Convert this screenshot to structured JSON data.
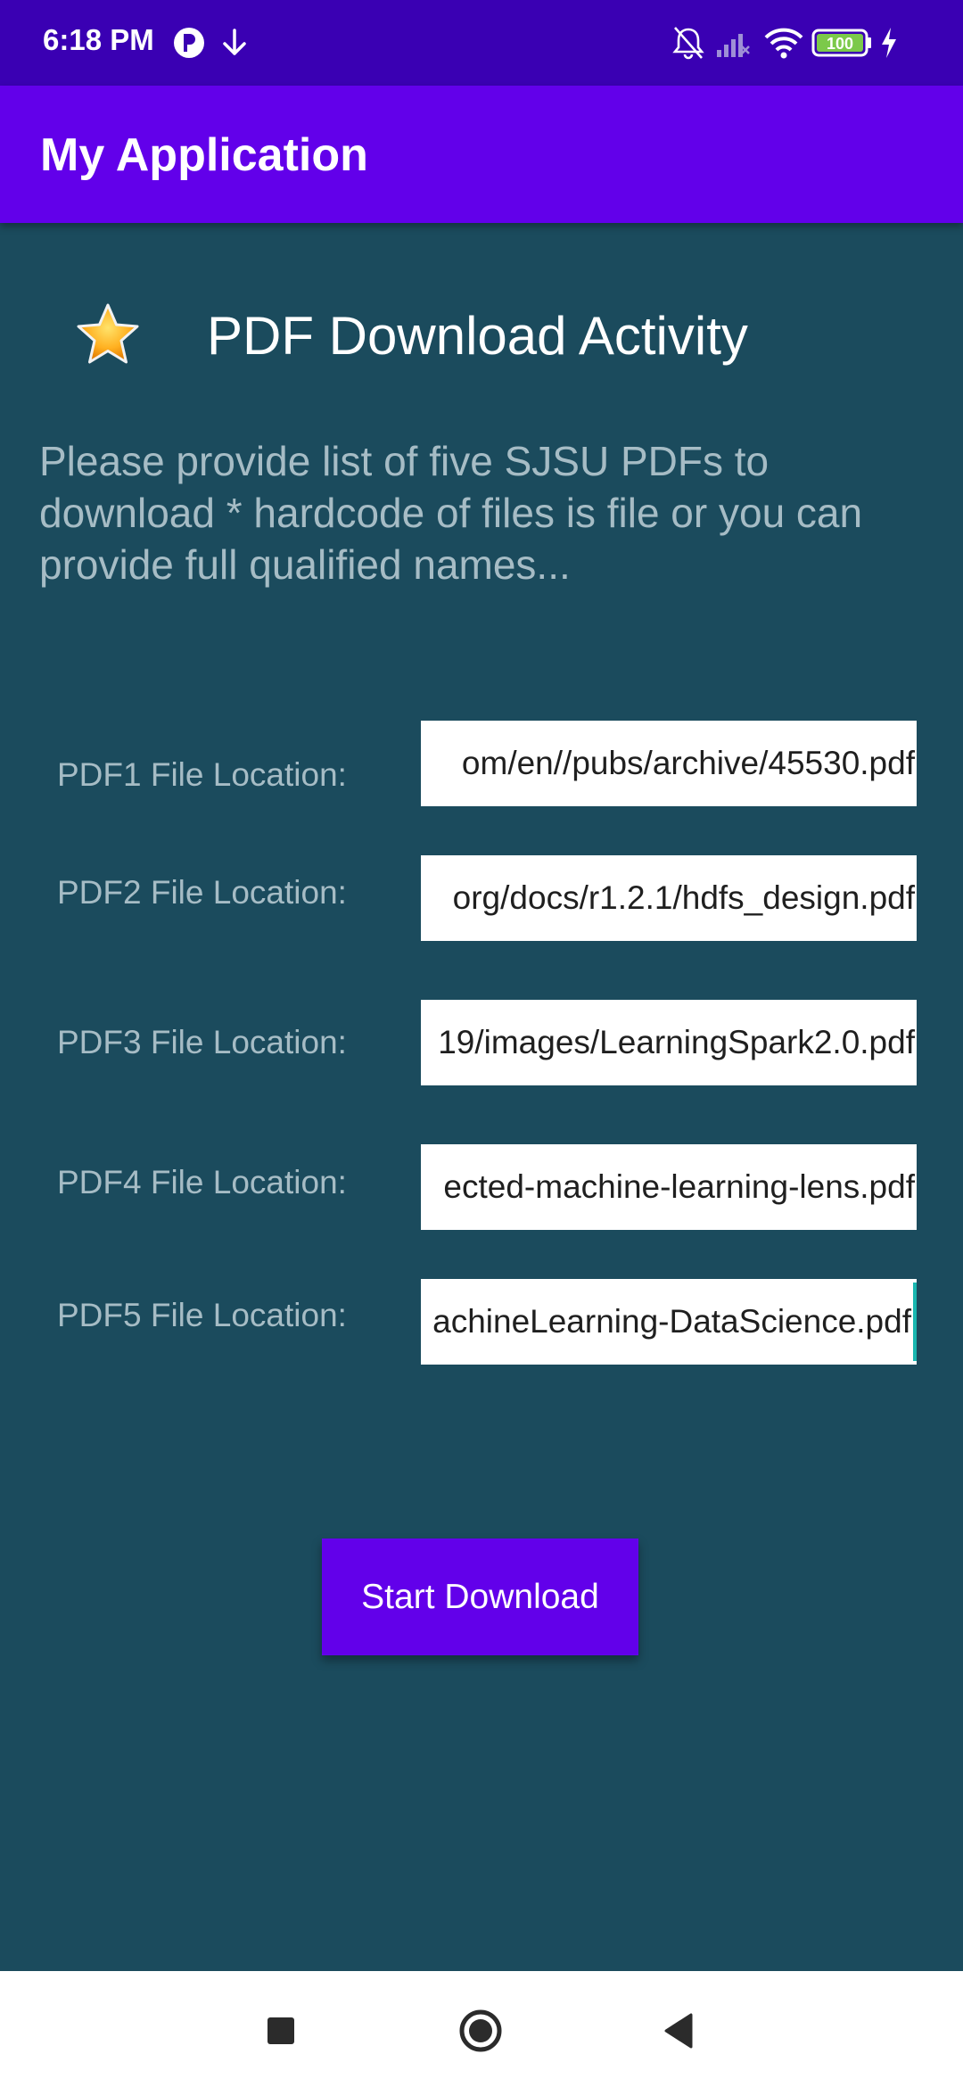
{
  "status_bar": {
    "time": "6:18 PM",
    "battery": "100",
    "icons": [
      "app-notification-icon",
      "download-icon",
      "bell-muted-icon",
      "signal-off-icon",
      "wifi-icon",
      "battery-icon",
      "charging-icon"
    ]
  },
  "app_bar": {
    "title": "My Application"
  },
  "header": {
    "icon": "star-icon",
    "title": "PDF Download Activity"
  },
  "instructions": "Please provide list of five SJSU PDFs to download * hardcode of files is file or you can provide full qualified names...",
  "rows": [
    {
      "label": "PDF1 File Location:",
      "value": "om/en//pubs/archive/45530.pdf"
    },
    {
      "label": "PDF2 File Location:",
      "value": "org/docs/r1.2.1/hdfs_design.pdf"
    },
    {
      "label": "PDF3 File Location:",
      "value": "19/images/LearningSpark2.0.pdf"
    },
    {
      "label": "PDF4 File Location:",
      "value": "ected-machine-learning-lens.pdf"
    },
    {
      "label": "PDF5 File Location:",
      "value": "achineLearning-DataScience.pdf"
    }
  ],
  "button": {
    "label": "Start Download"
  },
  "colors": {
    "status_bar": "#3a00b3",
    "app_bar": "#6200ea",
    "background": "#1b4b5d",
    "label_text": "#a6bcc5",
    "cursor": "#18b7b0"
  },
  "nav_bar": {
    "buttons": [
      "recents-square-icon",
      "home-circle-icon",
      "back-triangle-icon"
    ]
  }
}
